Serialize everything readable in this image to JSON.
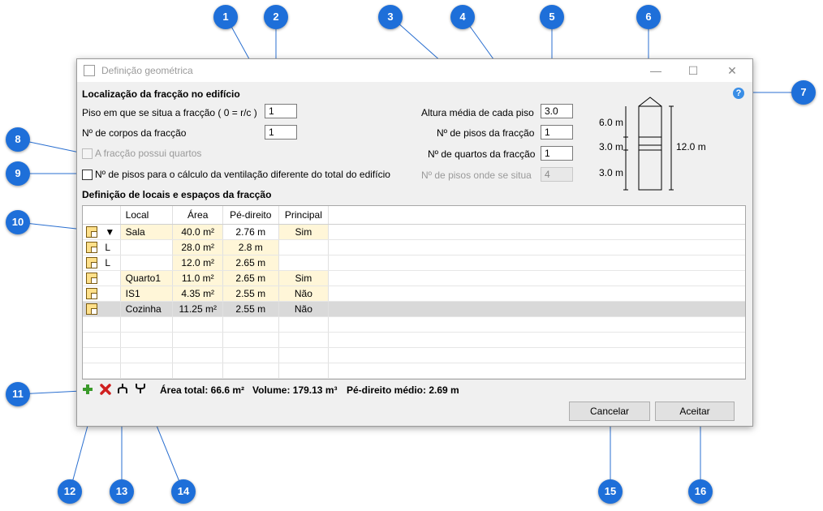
{
  "dialog": {
    "title": "Definição geométrica",
    "minimize": "—",
    "maximize": "☐",
    "close": "✕"
  },
  "location": {
    "section_title": "Localização da fracção no edifício",
    "floor_label": "Piso em que se situa a fracção ( 0 = r/c )",
    "floor_value": "1",
    "bodies_label": "Nº de corpos da fracção",
    "bodies_value": "1",
    "has_rooms_label": "A fracção possui quartos",
    "vent_label": "Nº de pisos para o cálculo da ventilação diferente do total do edifício",
    "avg_height_label": "Altura média de cada piso",
    "avg_height_value": "3.0",
    "floors_label": "Nº de pisos da fracção",
    "floors_value": "1",
    "rooms_label": "Nº de quartos da fracção",
    "rooms_value": "1",
    "floors_where_label": "Nº de pisos onde se situa",
    "floors_where_value": "4",
    "help_glyph": "?"
  },
  "building_diagram": {
    "top_label": "6.0 m",
    "mid_label": "3.0 m",
    "bottom_label": "3.0 m",
    "total_label": "12.0 m"
  },
  "spaces": {
    "section_title": "Definição de locais e espaços da fracção",
    "columns": [
      "Local",
      "Área",
      "Pé-direito",
      "Principal"
    ],
    "rows": [
      {
        "marker": "▼",
        "local": "Sala",
        "area": "40.0 m²",
        "height": "2.76 m",
        "principal": "Sim"
      },
      {
        "marker": "L",
        "local": "",
        "area": "28.0 m²",
        "height": "2.8 m",
        "principal": ""
      },
      {
        "marker": "L",
        "local": "",
        "area": "12.0 m²",
        "height": "2.65 m",
        "principal": ""
      },
      {
        "marker": "",
        "local": "Quarto1",
        "area": "11.0 m²",
        "height": "2.65 m",
        "principal": "Sim"
      },
      {
        "marker": "",
        "local": "IS1",
        "area": "4.35 m²",
        "height": "2.55 m",
        "principal": "Não"
      },
      {
        "marker": "",
        "local": "Cozinha",
        "area": "11.25 m²",
        "height": "2.55 m",
        "principal": "Não"
      }
    ]
  },
  "summary": {
    "area_total": "Área total: 66.6 m²",
    "volume": "Volume: 179.13 m³",
    "avg_height": "Pé-direito médio: 2.69 m"
  },
  "buttons": {
    "cancel": "Cancelar",
    "accept": "Aceitar"
  },
  "callouts": [
    "1",
    "2",
    "3",
    "4",
    "5",
    "6",
    "7",
    "8",
    "9",
    "10",
    "11",
    "12",
    "13",
    "14",
    "15",
    "16"
  ],
  "colors": {
    "callout": "#1e6fd9",
    "row_highlight": "#fff6d8",
    "selected_row": "#d9d9d9"
  }
}
